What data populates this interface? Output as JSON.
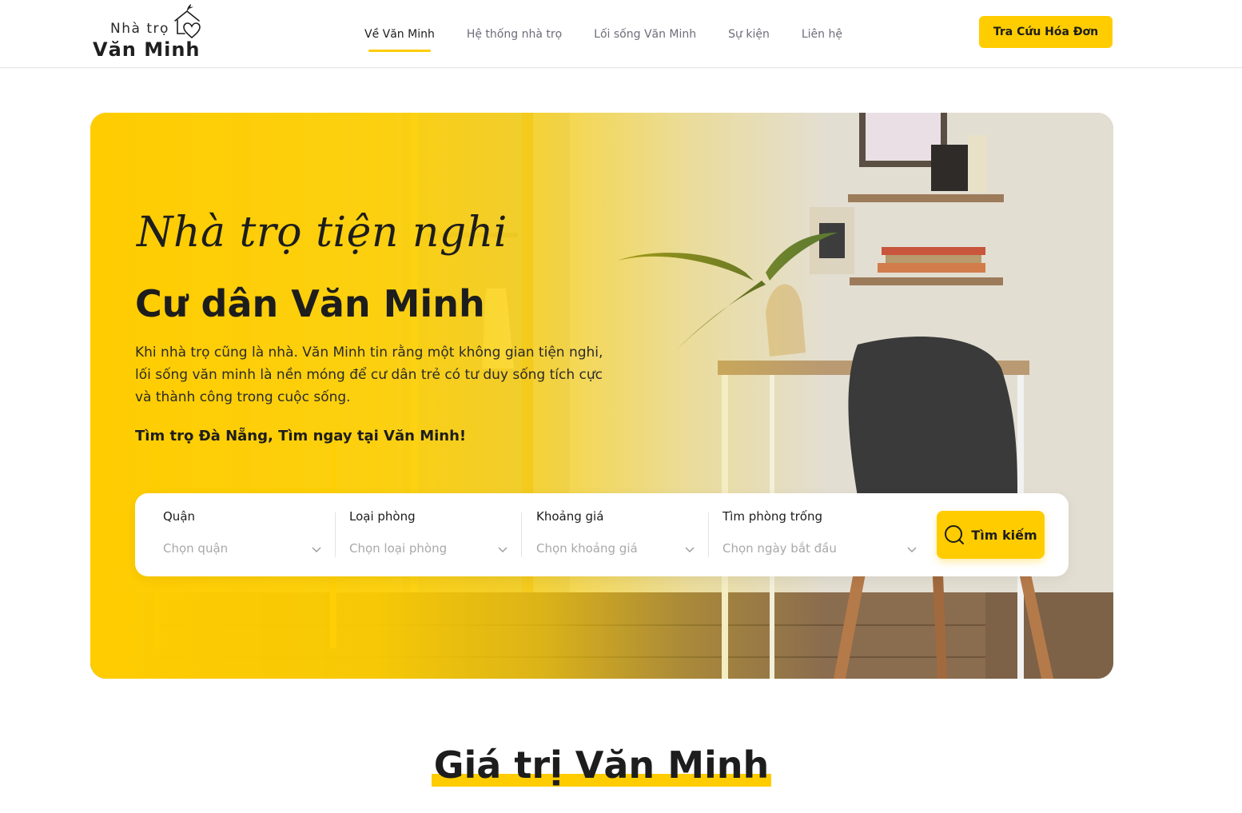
{
  "header": {
    "logo": {
      "line1": "Nhà trọ",
      "line2": "Văn Minh"
    },
    "nav": [
      {
        "label": "Về Văn Minh",
        "active": true
      },
      {
        "label": "Hệ thống nhà trọ",
        "active": false
      },
      {
        "label": "Lối sống Văn Minh",
        "active": false
      },
      {
        "label": "Sự kiện",
        "active": false
      },
      {
        "label": "Liên hệ",
        "active": false
      }
    ],
    "cta_label": "Tra Cứu Hóa Đơn"
  },
  "hero": {
    "script_title": "Nhà trọ tiện nghi",
    "title": "Cư dân Văn Minh",
    "description": "Khi nhà trọ cũng là nhà. Văn Minh tin rằng một không gian tiện nghi, lối sống văn minh là nền móng để cư dân trẻ có tư duy sống tích cực và thành công trong cuộc sống.",
    "tagline": "Tìm trọ Đà Nẵng, Tìm ngay tại Văn Minh!"
  },
  "search": {
    "fields": [
      {
        "label": "Quận",
        "placeholder": "Chọn quận"
      },
      {
        "label": "Loại phòng",
        "placeholder": "Chọn loại phòng"
      },
      {
        "label": "Khoảng giá",
        "placeholder": "Chọn khoảng giá"
      },
      {
        "label": "Tìm phòng trống",
        "placeholder": "Chọn ngày bắt đầu"
      }
    ],
    "button_label": "Tìm kiếm"
  },
  "section": {
    "title": "Giá trị Văn Minh"
  },
  "colors": {
    "accent": "#ffcc00",
    "text": "#1d1d1d",
    "muted": "#6d6d7a"
  }
}
